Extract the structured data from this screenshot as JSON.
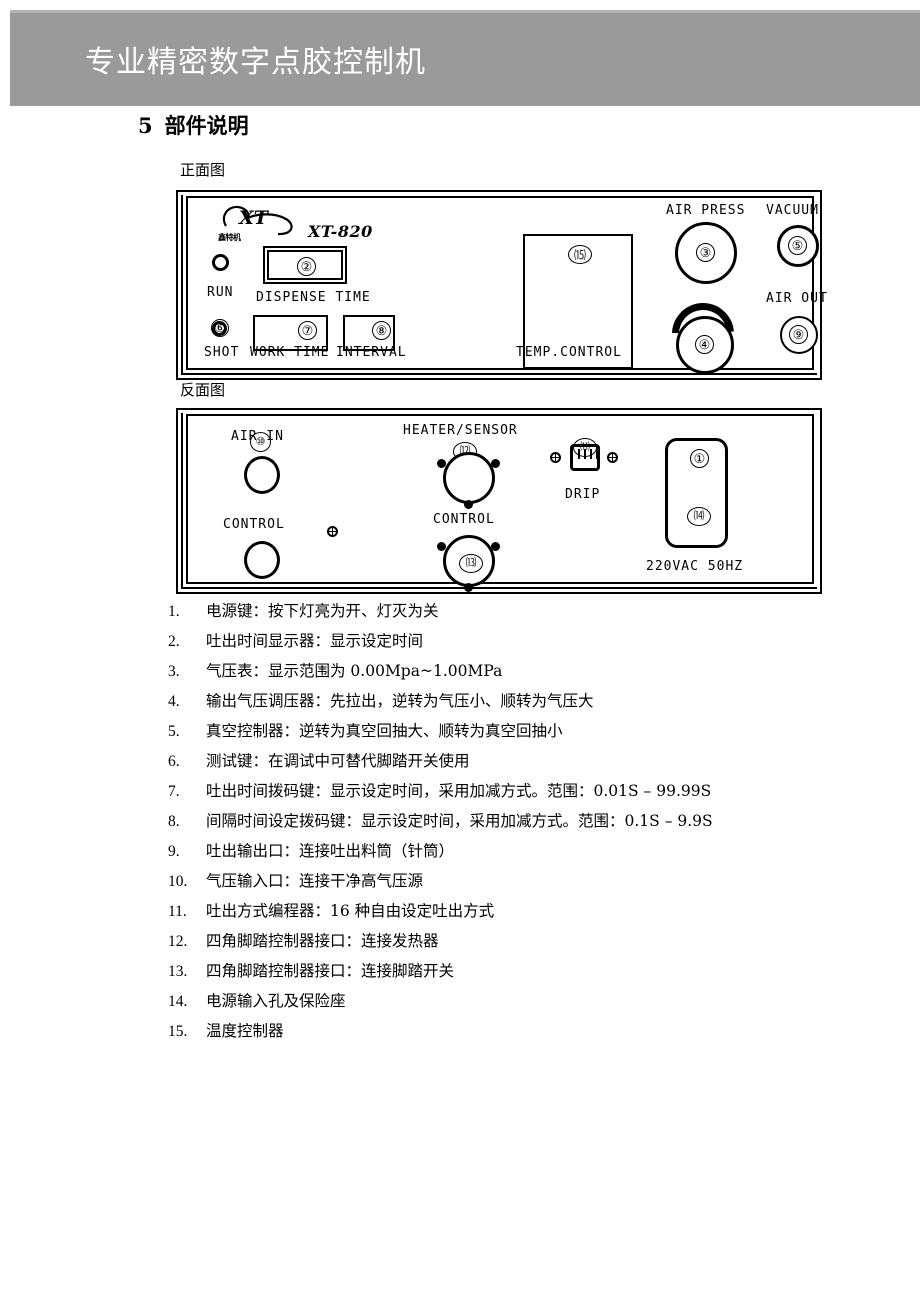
{
  "header": {
    "title": "专业精密数字点胶控制机",
    "background_color": "#9a9a9a",
    "text_color": "#ffffff"
  },
  "section": {
    "number": "5",
    "title": "部件说明"
  },
  "figures": {
    "front_caption": "正面图",
    "rear_caption": "反面图"
  },
  "front_panel": {
    "brand_logo": "XT",
    "brand_sub": "鑫特机",
    "model": "XT-820",
    "labels": {
      "run": "RUN",
      "shot": "SHOT",
      "dispense_time": "DISPENSE TIME",
      "work_time": "WORK TIME",
      "interval": "INTERVAL",
      "temp_control": "TEMP.CONTROL",
      "air_press": "AIR PRESS",
      "vacuum": "VACUUM",
      "air_out": "AIR OUT"
    },
    "refs": {
      "dispense_display": "②",
      "work_time": "⑦",
      "interval": "⑧",
      "shot": "⑥",
      "temp_controller": "⒂",
      "air_press_gauge": "③",
      "regulator": "④",
      "vacuum": "⑤",
      "air_out": "⑨"
    }
  },
  "rear_panel": {
    "labels": {
      "air_in": "AIR IN",
      "control_left": "CONTROL",
      "heater_sensor": "HEATER/SENSOR",
      "control_mid": "CONTROL",
      "drip": "DRIP",
      "power": "220VAC 50HZ"
    },
    "refs": {
      "air_in": "⑩",
      "heater_sensor": "⑿",
      "foot_control": "⒀",
      "drip_programmer": "⑾",
      "power_switch": "①",
      "fuse_socket": "⒁"
    }
  },
  "descriptions": [
    {
      "num": "1.",
      "text": "电源键：按下灯亮为开、灯灭为关"
    },
    {
      "num": "2.",
      "text": "吐出时间显示器：显示设定时间"
    },
    {
      "num": "3.",
      "text": "气压表：显示范围为 0.00Mpa~1.00MPa"
    },
    {
      "num": "4.",
      "text": "输出气压调压器：先拉出，逆转为气压小、顺转为气压大"
    },
    {
      "num": "5.",
      "text": "真空控制器：逆转为真空回抽大、顺转为真空回抽小"
    },
    {
      "num": "6.",
      "text": "测试键：在调试中可替代脚踏开关使用"
    },
    {
      "num": "7.",
      "text": "吐出时间拨码键：显示设定时间，采用加减方式。范围：0.01S – 99.99S"
    },
    {
      "num": "8.",
      "text": "间隔时间设定拨码键：显示设定时间，采用加减方式。范围：0.1S – 9.9S"
    },
    {
      "num": "9.",
      "text": "吐出输出口：连接吐出料筒（针筒）"
    },
    {
      "num": "10.",
      "text": "气压输入口：连接干净高气压源"
    },
    {
      "num": "11.",
      "text": "吐出方式编程器：16 种自由设定吐出方式"
    },
    {
      "num": "12.",
      "text": "四角脚踏控制器接口：连接发热器"
    },
    {
      "num": "13.",
      "text": "四角脚踏控制器接口：连接脚踏开关"
    },
    {
      "num": "14.",
      "text": "电源输入孔及保险座"
    },
    {
      "num": "15.",
      "text": "温度控制器"
    }
  ]
}
